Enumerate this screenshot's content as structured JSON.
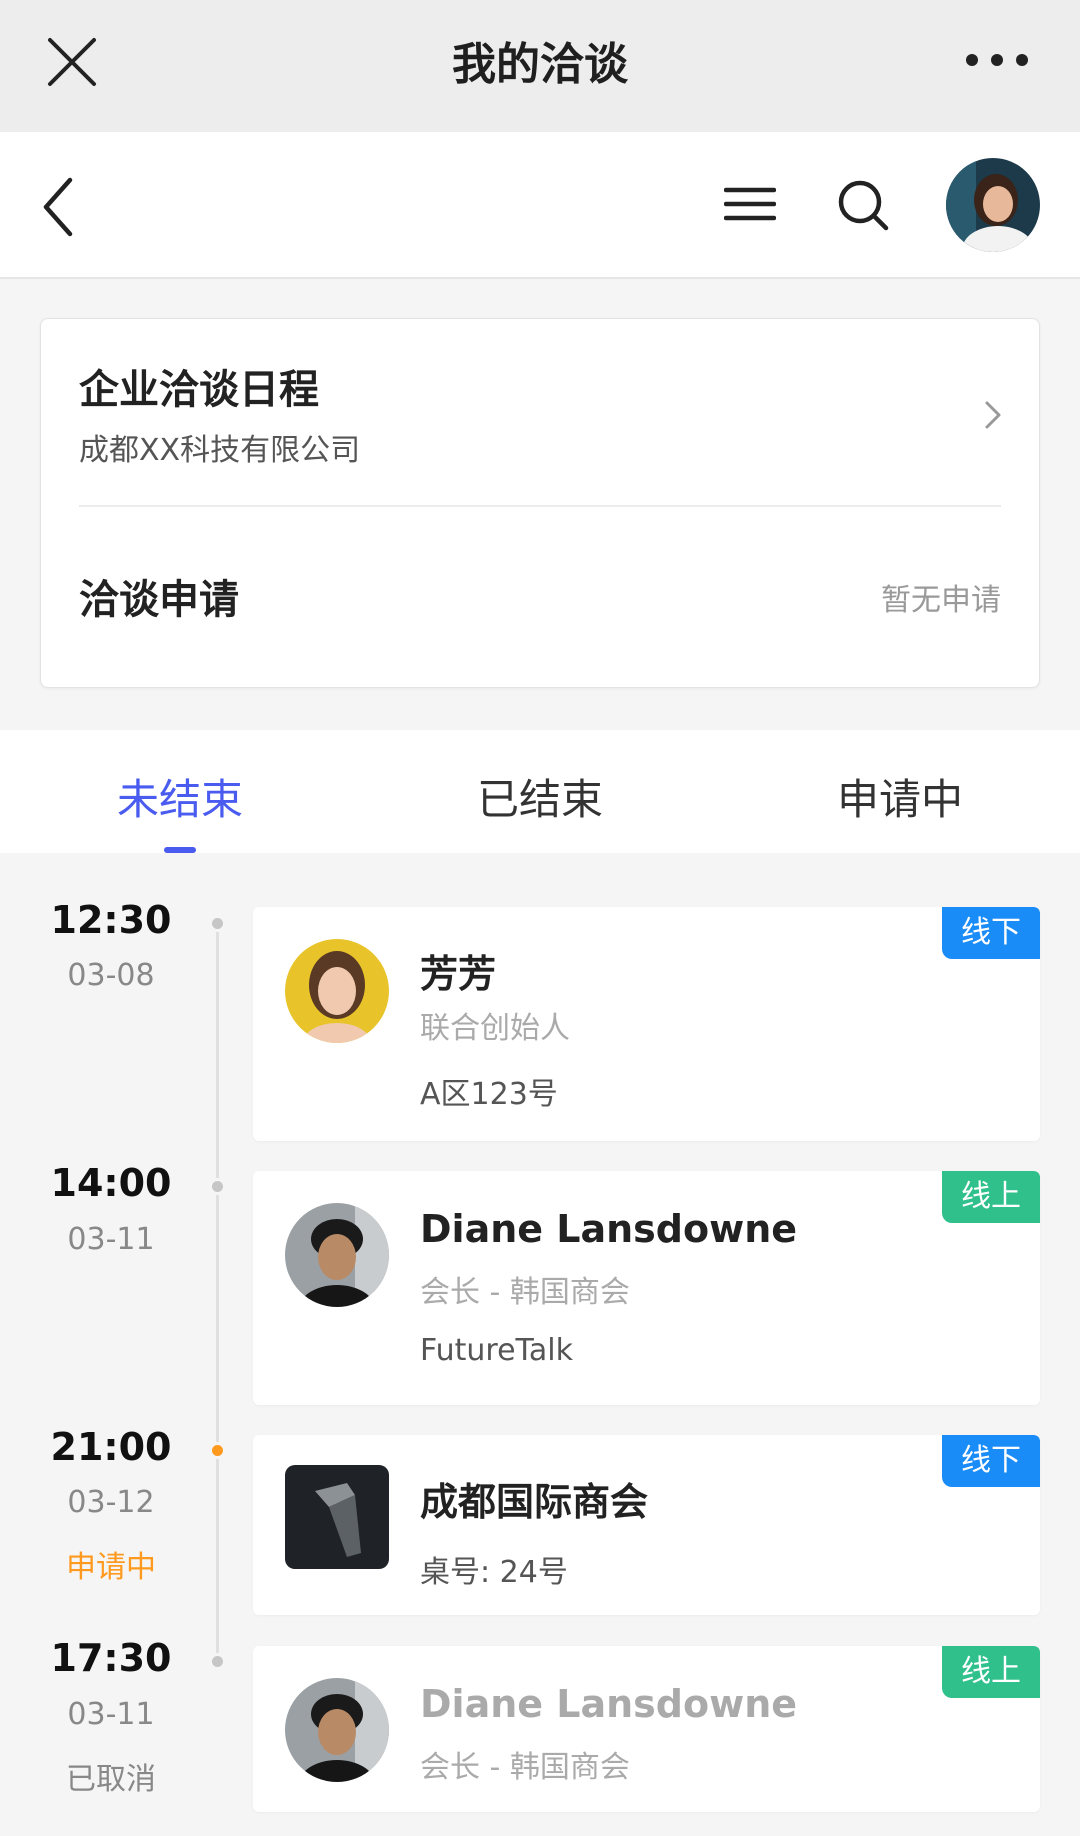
{
  "topbar": {
    "title": "我的洽谈"
  },
  "card": {
    "schedule_title": "企业洽谈日程",
    "company": "成都XX科技有限公司",
    "apply_title": "洽谈申请",
    "apply_value": "暂无申请"
  },
  "tabs": [
    {
      "label": "未结束"
    },
    {
      "label": "已结束"
    },
    {
      "label": "申请中"
    }
  ],
  "meetings": [
    {
      "time": "12:30",
      "date": "03-08",
      "status": "",
      "name": "芳芳",
      "role": "联合创始人",
      "location": "A区123号",
      "badge": "线下"
    },
    {
      "time": "14:00",
      "date": "03-11",
      "status": "",
      "name": "Diane Lansdowne",
      "role": "会长 - 韩国商会",
      "location": "FutureTalk",
      "badge": "线上"
    },
    {
      "time": "21:00",
      "date": "03-12",
      "status": "申请中",
      "name": "成都国际商会",
      "role": "",
      "location": "桌号: 24号",
      "badge": "线下"
    },
    {
      "time": "17:30",
      "date": "03-11",
      "status": "已取消",
      "name": "Diane Lansdowne",
      "role": "会长 - 韩国商会",
      "location": "",
      "badge": "线上"
    }
  ],
  "colors": {
    "accent": "#4a5cf0",
    "badge_offline": "#1a8cf7",
    "badge_online": "#2fc08c",
    "pending": "#ff9a1f"
  }
}
